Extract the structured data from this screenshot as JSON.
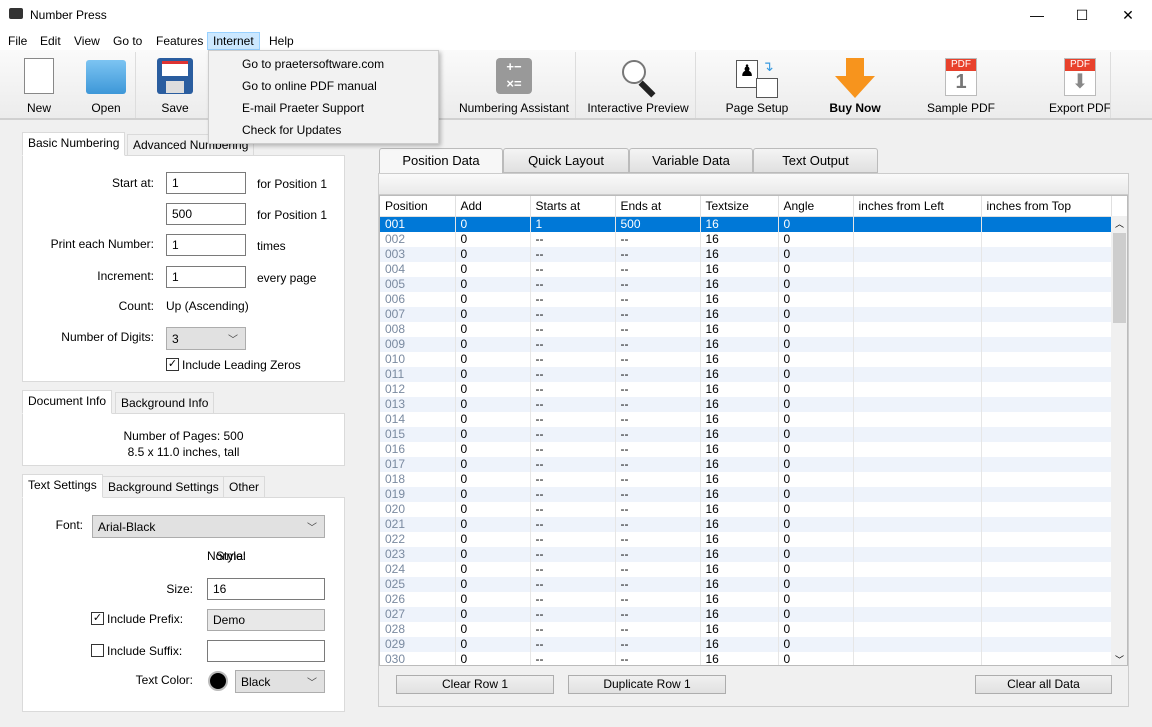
{
  "window": {
    "title": "Number Press",
    "controls": {
      "minimize": "—",
      "maximize": "☐",
      "close": "✕"
    }
  },
  "menu": [
    "File",
    "Edit",
    "View",
    "Go to",
    "Features",
    "Internet",
    "Help"
  ],
  "internet_menu": [
    "Go to praetersoftware.com",
    "Go to online PDF manual",
    "E-mail Praeter Support",
    "Check for Updates"
  ],
  "toolbar": {
    "new": "New",
    "open": "Open",
    "save": "Save",
    "numbering_assistant": "Numbering Assistant",
    "interactive_preview": "Interactive Preview",
    "page_setup": "Page Setup",
    "buy_now": "Buy Now",
    "sample_pdf": "Sample PDF",
    "export_pdf": "Export PDF",
    "pdf_badge": "PDF",
    "sample_digit": "1"
  },
  "numbering": {
    "tabs": [
      "Basic Numbering",
      "Advanced Numbering"
    ],
    "start_label": "Start at:",
    "start_value": "1",
    "start_suffix": "for Position 1",
    "end_value": "500",
    "end_suffix": "for Position 1",
    "print_label": "Print each Number:",
    "print_value": "1",
    "print_suffix": "times",
    "increment_label": "Increment:",
    "increment_value": "1",
    "increment_suffix": "every page",
    "count_label": "Count:",
    "count_value": "Up (Ascending)",
    "digits_label": "Number of Digits:",
    "digits_value": "3",
    "leading_zeros": "Include Leading Zeros",
    "leading_zeros_checked": true
  },
  "document": {
    "tabs": [
      "Document Info",
      "Background Info"
    ],
    "pages": "Number of Pages: 500",
    "size": "8.5 x 11.0 inches, tall"
  },
  "text": {
    "tabs": [
      "Text Settings",
      "Background Settings",
      "Other"
    ],
    "font_label": "Font:",
    "font_value": "Arial-Black",
    "style_label": "Style:",
    "style_value": "Normal",
    "size_label": "Size:",
    "size_value": "16",
    "prefix_label": "Include Prefix:",
    "prefix_checked": true,
    "prefix_value": "Demo",
    "suffix_label": "Include Suffix:",
    "suffix_checked": false,
    "suffix_value": "",
    "color_label": "Text Color:",
    "color_value": "Black",
    "color_hex": "#000000"
  },
  "right_tabs": [
    "Position Data",
    "Quick Layout",
    "Variable Data",
    "Text Output"
  ],
  "table": {
    "columns": [
      "Position",
      "Add",
      "Starts at",
      "Ends at",
      "Textsize",
      "Angle",
      "inches from Left",
      "inches from Top"
    ],
    "rows": [
      [
        "001",
        "0",
        "1",
        "500",
        "16",
        "0",
        "",
        ""
      ],
      [
        "002",
        "0",
        "--",
        "--",
        "16",
        "0",
        "",
        ""
      ],
      [
        "003",
        "0",
        "--",
        "--",
        "16",
        "0",
        "",
        ""
      ],
      [
        "004",
        "0",
        "--",
        "--",
        "16",
        "0",
        "",
        ""
      ],
      [
        "005",
        "0",
        "--",
        "--",
        "16",
        "0",
        "",
        ""
      ],
      [
        "006",
        "0",
        "--",
        "--",
        "16",
        "0",
        "",
        ""
      ],
      [
        "007",
        "0",
        "--",
        "--",
        "16",
        "0",
        "",
        ""
      ],
      [
        "008",
        "0",
        "--",
        "--",
        "16",
        "0",
        "",
        ""
      ],
      [
        "009",
        "0",
        "--",
        "--",
        "16",
        "0",
        "",
        ""
      ],
      [
        "010",
        "0",
        "--",
        "--",
        "16",
        "0",
        "",
        ""
      ],
      [
        "011",
        "0",
        "--",
        "--",
        "16",
        "0",
        "",
        ""
      ],
      [
        "012",
        "0",
        "--",
        "--",
        "16",
        "0",
        "",
        ""
      ],
      [
        "013",
        "0",
        "--",
        "--",
        "16",
        "0",
        "",
        ""
      ],
      [
        "014",
        "0",
        "--",
        "--",
        "16",
        "0",
        "",
        ""
      ],
      [
        "015",
        "0",
        "--",
        "--",
        "16",
        "0",
        "",
        ""
      ],
      [
        "016",
        "0",
        "--",
        "--",
        "16",
        "0",
        "",
        ""
      ],
      [
        "017",
        "0",
        "--",
        "--",
        "16",
        "0",
        "",
        ""
      ],
      [
        "018",
        "0",
        "--",
        "--",
        "16",
        "0",
        "",
        ""
      ],
      [
        "019",
        "0",
        "--",
        "--",
        "16",
        "0",
        "",
        ""
      ],
      [
        "020",
        "0",
        "--",
        "--",
        "16",
        "0",
        "",
        ""
      ],
      [
        "021",
        "0",
        "--",
        "--",
        "16",
        "0",
        "",
        ""
      ],
      [
        "022",
        "0",
        "--",
        "--",
        "16",
        "0",
        "",
        ""
      ],
      [
        "023",
        "0",
        "--",
        "--",
        "16",
        "0",
        "",
        ""
      ],
      [
        "024",
        "0",
        "--",
        "--",
        "16",
        "0",
        "",
        ""
      ],
      [
        "025",
        "0",
        "--",
        "--",
        "16",
        "0",
        "",
        ""
      ],
      [
        "026",
        "0",
        "--",
        "--",
        "16",
        "0",
        "",
        ""
      ],
      [
        "027",
        "0",
        "--",
        "--",
        "16",
        "0",
        "",
        ""
      ],
      [
        "028",
        "0",
        "--",
        "--",
        "16",
        "0",
        "",
        ""
      ],
      [
        "029",
        "0",
        "--",
        "--",
        "16",
        "0",
        "",
        ""
      ],
      [
        "030",
        "0",
        "--",
        "--",
        "16",
        "0",
        "",
        ""
      ]
    ],
    "selected_row": "001"
  },
  "buttons": {
    "clear_row": "Clear Row 1",
    "duplicate_row": "Duplicate Row 1",
    "clear_all": "Clear all Data"
  },
  "colors": {
    "selection": "#0078d7",
    "alt_row": "#eef3fb",
    "buy_arrow": "#f7941d",
    "pdf_red": "#e8412c"
  }
}
